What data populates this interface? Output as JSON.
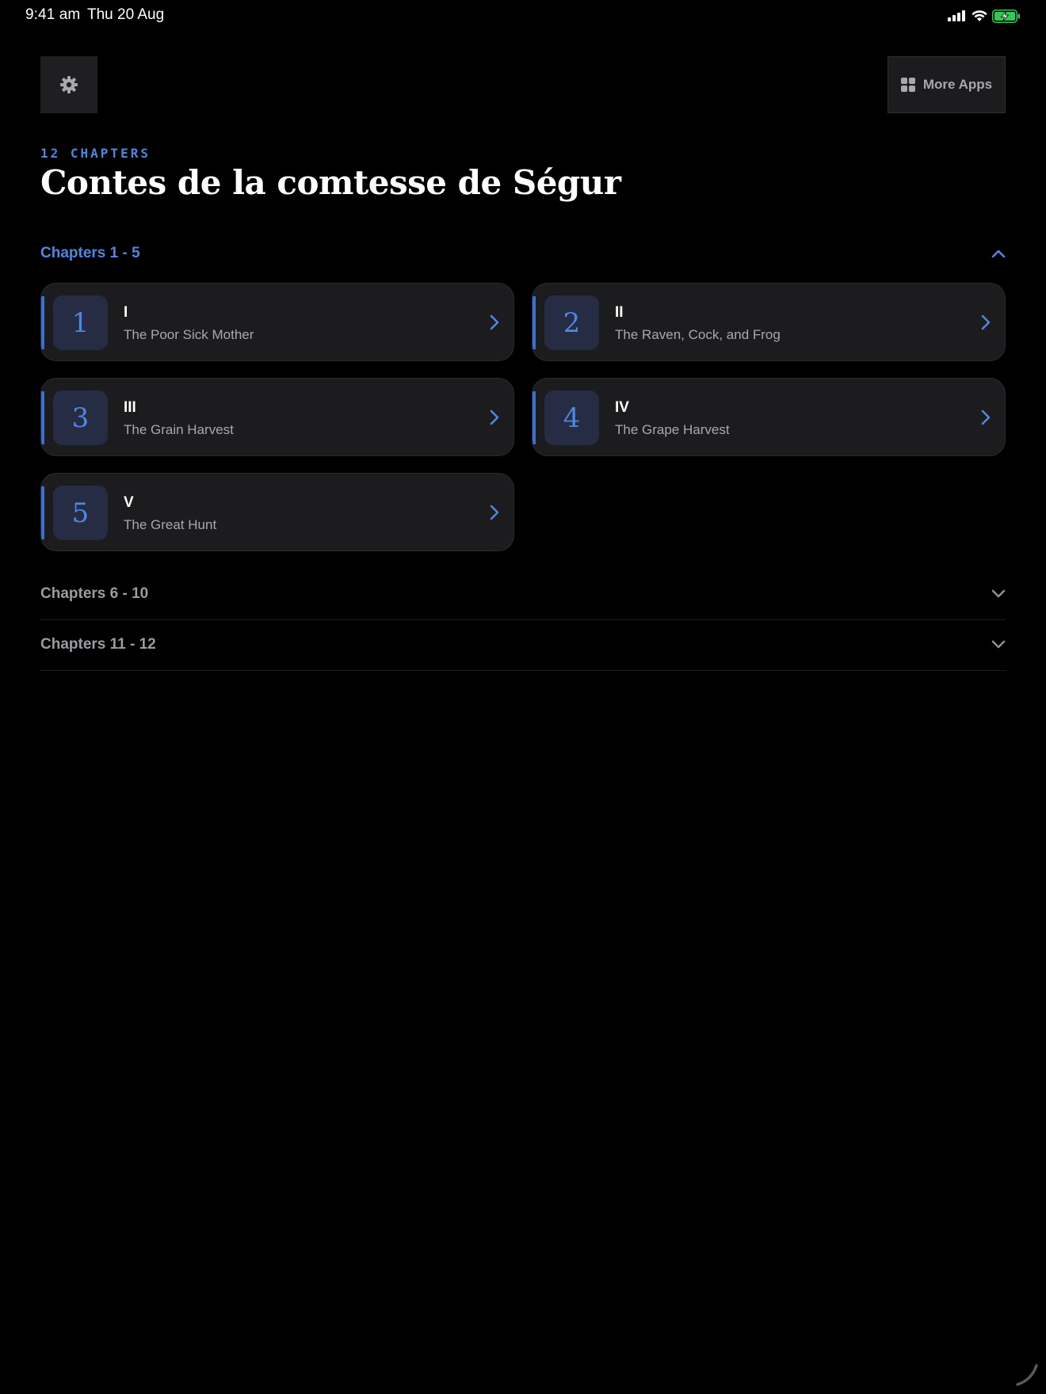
{
  "status_bar": {
    "time": "9:41 am",
    "date": "Thu 20 Aug",
    "battery_color": "#34c759"
  },
  "toolbar": {
    "settings_icon": "gear-icon",
    "more_apps_label": "More Apps",
    "more_apps_icon": "grid-icon"
  },
  "header": {
    "eyebrow": "12 CHAPTERS",
    "title": "Contes de la comtesse de Ségur"
  },
  "sections": [
    {
      "label": "Chapters 1 - 5",
      "expanded": true,
      "chapters": [
        {
          "number": "1",
          "roman": "I",
          "title": "The Poor Sick Mother"
        },
        {
          "number": "2",
          "roman": "II",
          "title": "The Raven, Cock, and Frog"
        },
        {
          "number": "3",
          "roman": "III",
          "title": "The Grain Harvest"
        },
        {
          "number": "4",
          "roman": "IV",
          "title": "The Grape Harvest"
        },
        {
          "number": "5",
          "roman": "V",
          "title": "The Great Hunt"
        }
      ]
    },
    {
      "label": "Chapters 6 - 10",
      "expanded": false
    },
    {
      "label": "Chapters 11 - 12",
      "expanded": false
    }
  ],
  "colors": {
    "accent": "#4f86e0",
    "background": "#000000",
    "card": "#1c1c1e",
    "muted_text": "#a8a8ad"
  }
}
